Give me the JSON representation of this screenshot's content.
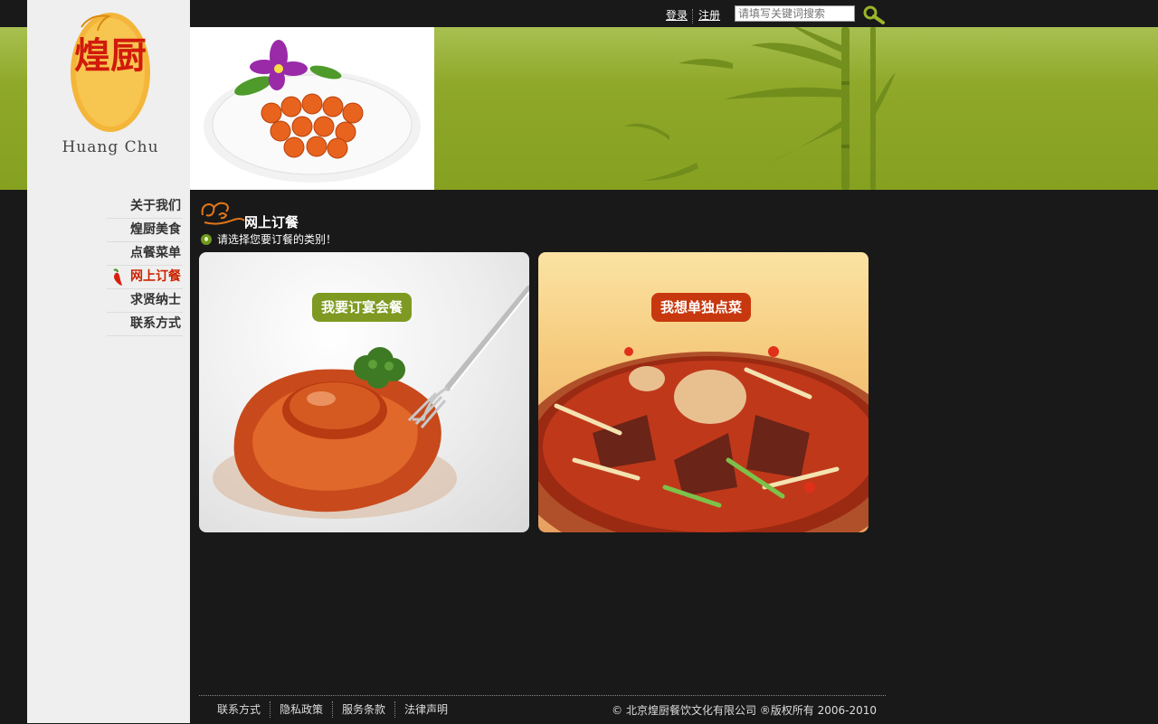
{
  "header": {
    "login_label": "登录",
    "register_label": "注册",
    "search_placeholder": "请填写关键词搜索",
    "search_icon": "magnifier-icon"
  },
  "logo": {
    "brand_cn": "煌厨",
    "brand_en": "Huang Chu"
  },
  "sidebar": {
    "items": [
      {
        "label": "关于我们",
        "active": false
      },
      {
        "label": "煌厨美食",
        "active": false
      },
      {
        "label": "点餐菜单",
        "active": false
      },
      {
        "label": "网上订餐",
        "active": true
      },
      {
        "label": "求贤纳士",
        "active": false
      },
      {
        "label": "联系方式",
        "active": false
      }
    ]
  },
  "main": {
    "title": "网上订餐",
    "hint": "请选择您要订餐的类别！",
    "cards": [
      {
        "label": "我要订宴会餐",
        "color": "#7e9a22"
      },
      {
        "label": "我想单独点菜",
        "color": "#c8380e"
      }
    ]
  },
  "footer": {
    "links": [
      "联系方式",
      "隐私政策",
      "服务条款",
      "法律声明"
    ],
    "copyright": "© 北京煌厨餐饮文化有限公司 ®版权所有 2006-2010"
  },
  "colors": {
    "background": "#191919",
    "accent_green": "#8fa82a",
    "active_red": "#cc2200"
  }
}
